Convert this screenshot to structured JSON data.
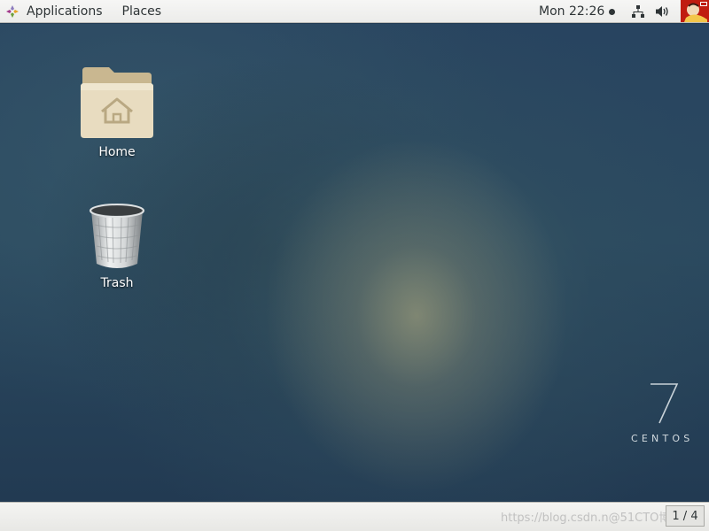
{
  "top_panel": {
    "applications_label": "Applications",
    "places_label": "Places",
    "clock_text": "Mon 22:26"
  },
  "desktop": {
    "icons": [
      {
        "label": "Home",
        "icon": "home-folder-icon"
      },
      {
        "label": "Trash",
        "icon": "trash-icon"
      }
    ],
    "branding": {
      "version": "7",
      "wordmark": "CENTOS"
    }
  },
  "bottom_panel": {
    "watermark": "https://blog.csdn.n@51CTO博客",
    "workspace_indicator": "1 / 4"
  },
  "colors": {
    "panel_bg": "#ececea",
    "panel_text": "#2e3436",
    "wallpaper_base": "#284460",
    "folder": "#e2d5b7"
  }
}
